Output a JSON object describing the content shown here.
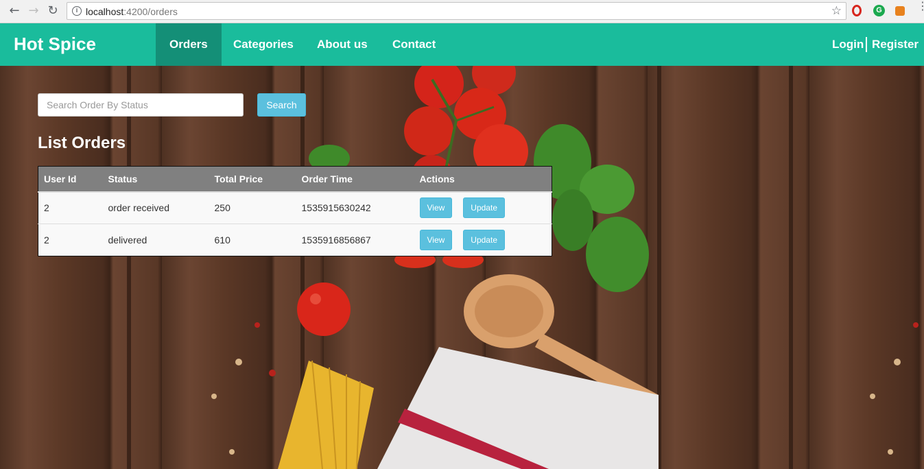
{
  "browser": {
    "url_host": "localhost",
    "url_path": ":4200/orders"
  },
  "navbar": {
    "brand": "Hot Spice",
    "items": [
      {
        "label": "Orders",
        "active": true
      },
      {
        "label": "Categories",
        "active": false
      },
      {
        "label": "About us",
        "active": false
      },
      {
        "label": "Contact",
        "active": false
      }
    ],
    "login_label": "Login",
    "register_label": "Register"
  },
  "search": {
    "placeholder": "Search Order By Status",
    "value": "",
    "button_label": "Search"
  },
  "main": {
    "title": "List Orders"
  },
  "table": {
    "headers": [
      "User Id",
      "Status",
      "Total Price",
      "Order Time",
      "Actions"
    ],
    "rows": [
      {
        "user_id": "2",
        "status": "order received",
        "total_price": "250",
        "order_time": "1535915630242",
        "view_label": "View",
        "update_label": "Update"
      },
      {
        "user_id": "2",
        "status": "delivered",
        "total_price": "610",
        "order_time": "1535916856867",
        "view_label": "View",
        "update_label": "Update"
      }
    ]
  },
  "colors": {
    "navbar": "#1abc9c",
    "navbar_active": "#148f77",
    "button": "#5bc0de",
    "table_header": "#808080"
  }
}
